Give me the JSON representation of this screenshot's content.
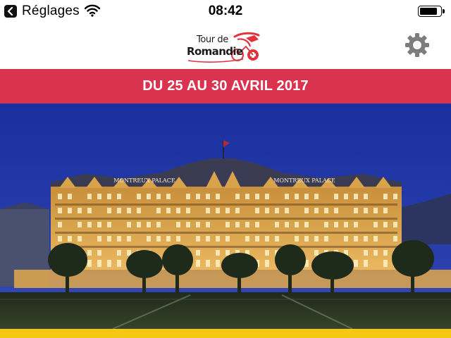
{
  "status_bar": {
    "back_app_label": "Réglages",
    "time": "08:42",
    "battery_level": 0.85
  },
  "header": {
    "logo": {
      "line1": "Tour de",
      "line2": "Romandie"
    },
    "settings_icon": "gear-icon"
  },
  "banner": {
    "text": "DU 25 AU 30 AVRIL 2017",
    "color": "#d9334f"
  },
  "hero": {
    "signs": [
      "MONTREUX PALACE",
      "MONTREUX PALACE"
    ]
  },
  "colors": {
    "accent": "#d9334f",
    "bottom_strip": "#f4c712",
    "sky": "#1d2f9c"
  }
}
